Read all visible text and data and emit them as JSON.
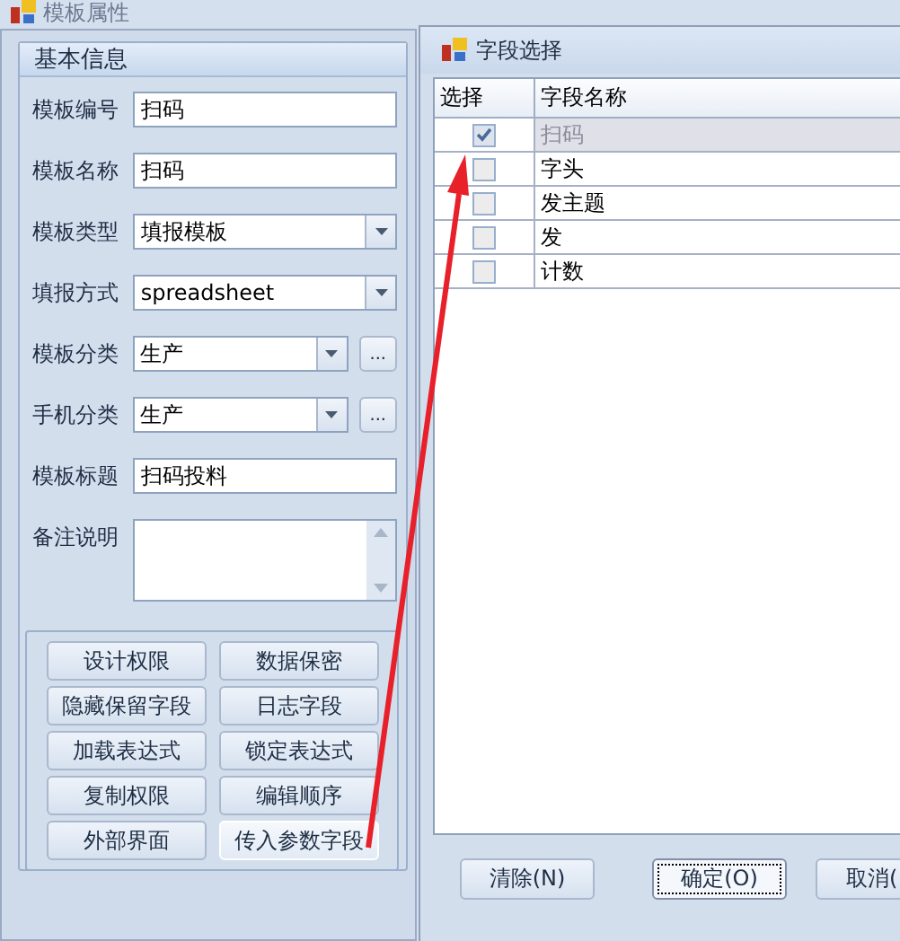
{
  "background_window": {
    "title": "模板属性",
    "group_title": "基本信息",
    "fields": [
      {
        "kind": "text",
        "label": "模板编号",
        "value": "扫码"
      },
      {
        "kind": "text",
        "label": "模板名称",
        "value": "扫码"
      },
      {
        "kind": "combo",
        "label": "模板类型",
        "value": "填报模板"
      },
      {
        "kind": "combo",
        "label": "填报方式",
        "value": "spreadsheet"
      },
      {
        "kind": "combo_more",
        "label": "模板分类",
        "value": "生产",
        "more": "..."
      },
      {
        "kind": "combo_more",
        "label": "手机分类",
        "value": "生产",
        "more": "..."
      },
      {
        "kind": "text",
        "label": "模板标题",
        "value": "扫码投料"
      },
      {
        "kind": "memo",
        "label": "备注说明"
      }
    ],
    "buttons": [
      {
        "label": "设计权限",
        "focused": false
      },
      {
        "label": "数据保密",
        "focused": false
      },
      {
        "label": "隐藏保留字段",
        "focused": false
      },
      {
        "label": "日志字段",
        "focused": false
      },
      {
        "label": "加载表达式",
        "focused": false
      },
      {
        "label": "锁定表达式",
        "focused": false
      },
      {
        "label": "复制权限",
        "focused": false
      },
      {
        "label": "编辑顺序",
        "focused": false
      },
      {
        "label": "外部界面",
        "focused": false
      },
      {
        "label": "传入参数字段",
        "focused": true
      }
    ]
  },
  "dialog": {
    "title": "字段选择",
    "columns": [
      "选择",
      "字段名称"
    ],
    "rows": [
      {
        "name": "扫码",
        "checked": true,
        "disabled": true
      },
      {
        "name": "字头",
        "checked": false,
        "disabled": false
      },
      {
        "name": "发主题",
        "checked": false,
        "disabled": false
      },
      {
        "name": "发",
        "checked": false,
        "disabled": false
      },
      {
        "name": "计数",
        "checked": false,
        "disabled": false
      }
    ],
    "buttons": [
      {
        "label": "清除(N)",
        "focused": false
      },
      {
        "label": "确定(O)",
        "focused": true
      },
      {
        "label": "取消(",
        "focused": false
      }
    ]
  }
}
